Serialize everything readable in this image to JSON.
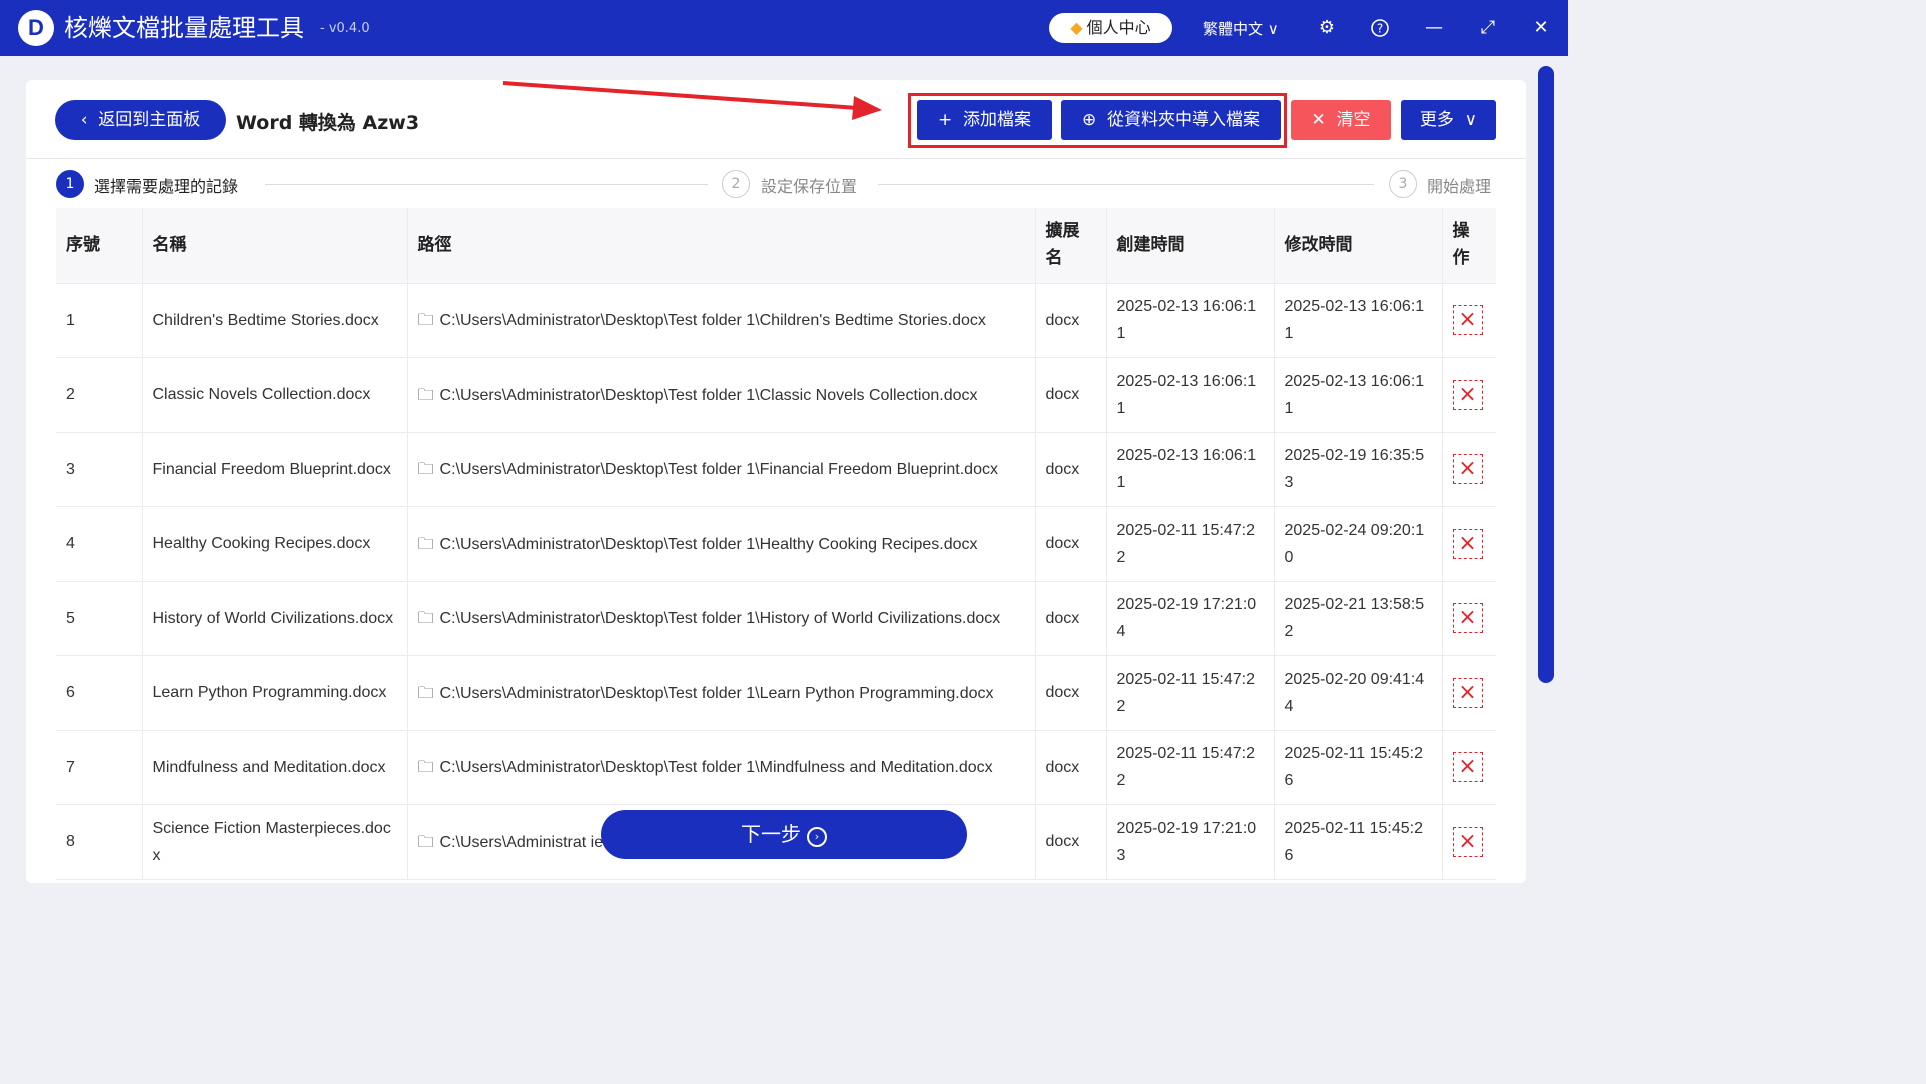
{
  "app": {
    "logo_letter": "D",
    "title": "核爍文檔批量處理工具",
    "version": "- v0.4.0",
    "user_center": "個人中心",
    "language": "繁體中文"
  },
  "icons": {
    "logo": "logo-icon",
    "gem": "gem-icon",
    "settings": "gear-icon",
    "help": "question-icon",
    "minimize": "minimize-icon",
    "maximize": "maximize-icon",
    "close": "close-icon",
    "folder": "folder-icon",
    "delete": "delete-x-icon"
  },
  "colors": {
    "primary": "#1b2fbf",
    "danger": "#f5555b",
    "highlight": "#e4232b"
  },
  "header": {
    "back_label": "返回到主面板",
    "page_title": "Word 轉換為 Azw3",
    "add_file": "添加檔案",
    "import_folder": "從資料夾中導入檔案",
    "clear": "清空",
    "more": "更多"
  },
  "steps": [
    {
      "num": "1",
      "label": "選擇需要處理的記錄"
    },
    {
      "num": "2",
      "label": "設定保存位置"
    },
    {
      "num": "3",
      "label": "開始處理"
    }
  ],
  "table": {
    "headers": [
      "序號",
      "名稱",
      "路徑",
      "擴展名",
      "創建時間",
      "修改時間",
      "操作"
    ],
    "rows": [
      {
        "no": "1",
        "name": "Children's Bedtime Stories.docx",
        "path": "C:\\Users\\Administrator\\Desktop\\Test folder 1\\Children's Bedtime Stories.docx",
        "ext": "docx",
        "created": "2025-02-13 16:06:11",
        "modified": "2025-02-13 16:06:11"
      },
      {
        "no": "2",
        "name": "Classic Novels Collection.docx",
        "path": "C:\\Users\\Administrator\\Desktop\\Test folder 1\\Classic Novels Collection.docx",
        "ext": "docx",
        "created": "2025-02-13 16:06:11",
        "modified": "2025-02-13 16:06:11"
      },
      {
        "no": "3",
        "name": "Financial Freedom Blueprint.docx",
        "path": "C:\\Users\\Administrator\\Desktop\\Test folder 1\\Financial Freedom Blueprint.docx",
        "ext": "docx",
        "created": "2025-02-13 16:06:11",
        "modified": "2025-02-19 16:35:53"
      },
      {
        "no": "4",
        "name": "Healthy Cooking Recipes.docx",
        "path": "C:\\Users\\Administrator\\Desktop\\Test folder 1\\Healthy Cooking Recipes.docx",
        "ext": "docx",
        "created": "2025-02-11 15:47:22",
        "modified": "2025-02-24 09:20:10"
      },
      {
        "no": "5",
        "name": "History of World Civilizations.docx",
        "path": "C:\\Users\\Administrator\\Desktop\\Test folder 1\\History of World Civilizations.docx",
        "ext": "docx",
        "created": "2025-02-19 17:21:04",
        "modified": "2025-02-21 13:58:52"
      },
      {
        "no": "6",
        "name": "Learn Python Programming.docx",
        "path": "C:\\Users\\Administrator\\Desktop\\Test folder 1\\Learn Python Programming.docx",
        "ext": "docx",
        "created": "2025-02-11 15:47:22",
        "modified": "2025-02-20 09:41:44"
      },
      {
        "no": "7",
        "name": "Mindfulness and Meditation.docx",
        "path": "C:\\Users\\Administrator\\Desktop\\Test folder 1\\Mindfulness and Meditation.docx",
        "ext": "docx",
        "created": "2025-02-11 15:47:22",
        "modified": "2025-02-11 15:45:26"
      },
      {
        "no": "8",
        "name": "Science Fiction Masterpieces.docx",
        "path": "C:\\Users\\Administrat ieces.docx",
        "ext": "docx",
        "created": "2025-02-19 17:21:03",
        "modified": "2025-02-11 15:45:26"
      }
    ]
  },
  "footer": {
    "next_label": "下一步"
  }
}
